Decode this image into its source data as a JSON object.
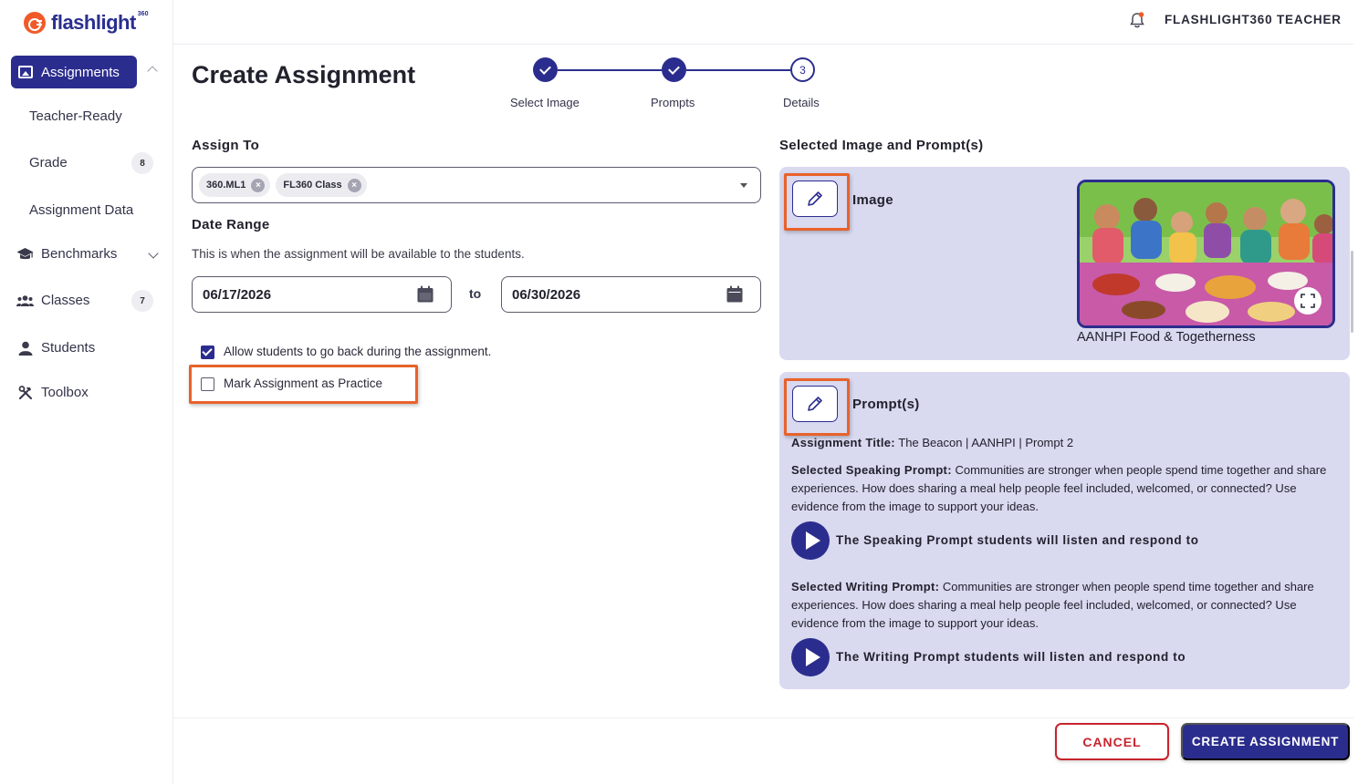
{
  "brand": {
    "name": "flashlight",
    "superscript": "360",
    "accent": "#f05a28",
    "primary": "#2b2d8e"
  },
  "sidebar": {
    "active": {
      "label": "Assignments",
      "icon": "image-icon"
    },
    "sub_items": [
      {
        "label": "Teacher-Ready"
      },
      {
        "label": "Grade",
        "badge": "8"
      },
      {
        "label": "Assignment Data"
      }
    ],
    "items": [
      {
        "label": "Benchmarks",
        "icon": "graduation-cap-icon"
      },
      {
        "label": "Classes",
        "icon": "users-icon",
        "badge": "7"
      },
      {
        "label": "Students",
        "icon": "user-icon"
      },
      {
        "label": "Toolbox",
        "icon": "tools-icon"
      }
    ]
  },
  "header": {
    "user": "FLASHLIGHT360 TEACHER",
    "notification_icon": "bell-icon"
  },
  "page": {
    "title": "Create Assignment"
  },
  "stepper": {
    "steps": [
      {
        "label": "Select Image",
        "status": "complete"
      },
      {
        "label": "Prompts",
        "status": "complete"
      },
      {
        "label": "Details",
        "status": "current",
        "number": "3"
      }
    ]
  },
  "form": {
    "assign_to": {
      "label": "Assign To",
      "chips": [
        "360.ML1",
        "FL360 Class"
      ]
    },
    "date_range": {
      "label": "Date Range",
      "helper": "This is when the assignment will be available to the students.",
      "start": "06/17/2026",
      "separator": "to",
      "end": "06/30/2026"
    },
    "options": [
      {
        "label": "Allow students to go back during the assignment.",
        "checked": true
      },
      {
        "label": "Mark Assignment as Practice",
        "checked": false
      }
    ]
  },
  "selected": {
    "heading": "Selected Image and Prompt(s)",
    "image": {
      "heading": "Image",
      "caption": "AANHPI Food & Togetherness"
    },
    "prompts": {
      "heading": "Prompt(s)",
      "title_label": "Assignment Title:",
      "title_value": "The Beacon | AANHPI | Prompt 2",
      "speaking_label": "Selected Speaking Prompt:",
      "speaking_text": "Communities are stronger when people spend time together and share experiences. How does sharing a meal help people feel included, welcomed, or connected? Use evidence from the image to support your ideas.",
      "speaking_audio": "The Speaking Prompt students will listen and respond to",
      "writing_label": "Selected Writing Prompt:",
      "writing_text": "Communities are stronger when people spend time together and share experiences. How does sharing a meal help people feel included, welcomed, or connected? Use evidence from the image to support your ideas.",
      "writing_audio": "The Writing Prompt students will listen and respond to"
    }
  },
  "footer": {
    "cancel": "CANCEL",
    "create": "CREATE ASSIGNMENT"
  }
}
